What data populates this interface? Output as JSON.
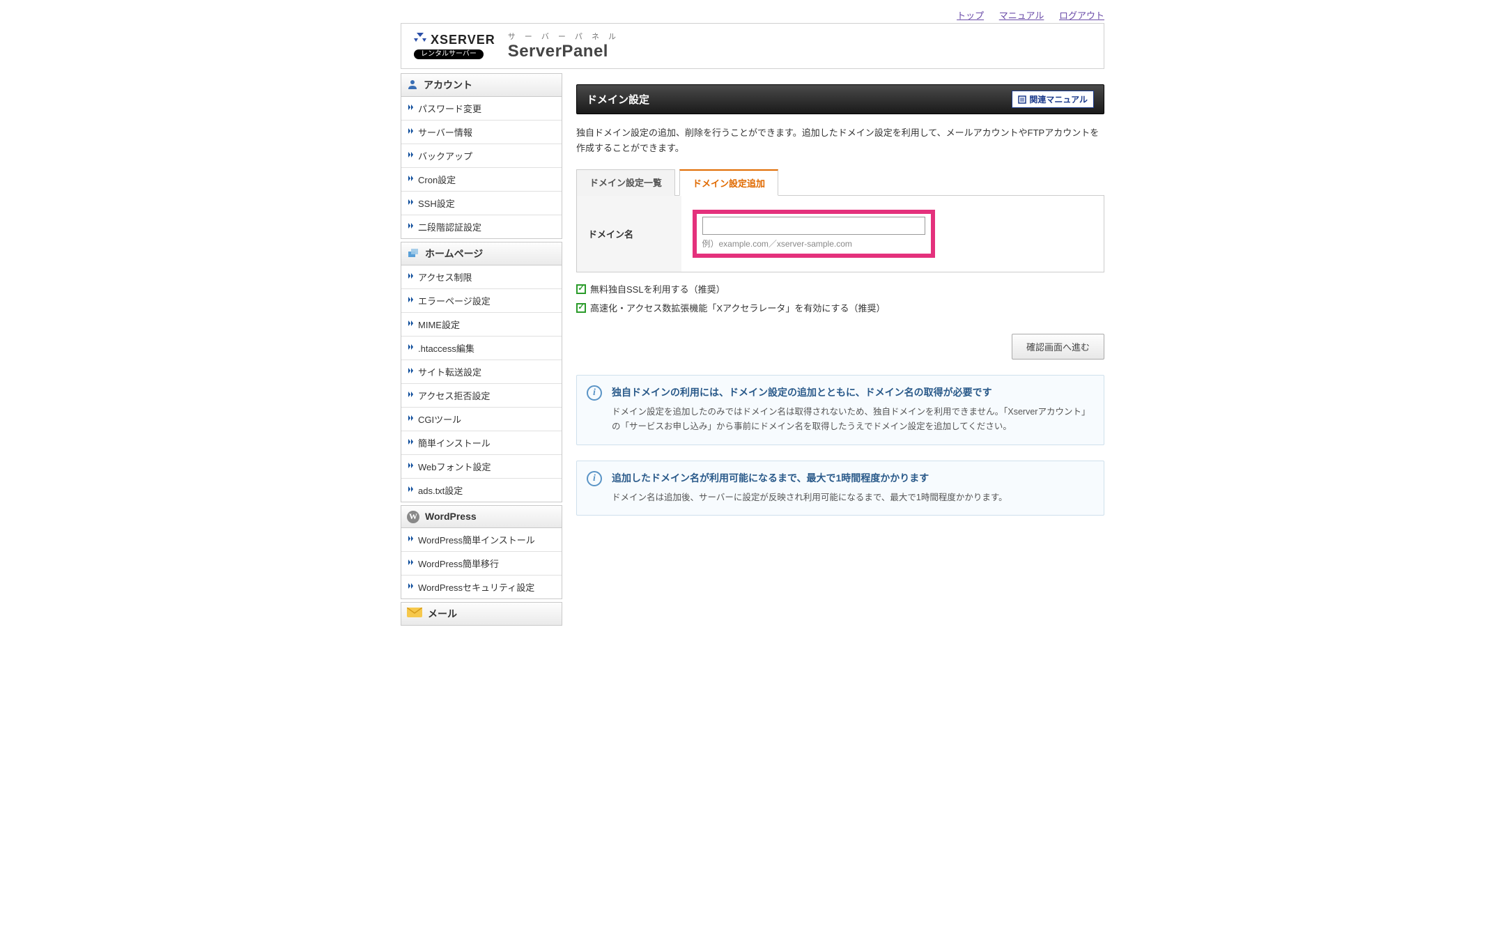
{
  "topnav": {
    "links": [
      "トップ",
      "マニュアル",
      "ログアウト"
    ]
  },
  "header": {
    "brand": "XSERVER",
    "badge": "レンタルサーバー",
    "panel_jp": "サ ー バ ー パ ネ ル",
    "panel_en": "ServerPanel"
  },
  "sidebar": {
    "sections": [
      {
        "title": "アカウント",
        "icon": "account-icon",
        "items": [
          "パスワード変更",
          "サーバー情報",
          "バックアップ",
          "Cron設定",
          "SSH設定",
          "二段階認証設定"
        ]
      },
      {
        "title": "ホームページ",
        "icon": "home-icon",
        "items": [
          "アクセス制限",
          "エラーページ設定",
          "MIME設定",
          ".htaccess編集",
          "サイト転送設定",
          "アクセス拒否設定",
          "CGIツール",
          "簡単インストール",
          "Webフォント設定",
          "ads.txt設定"
        ]
      },
      {
        "title": "WordPress",
        "icon": "wordpress-icon",
        "items": [
          "WordPress簡単インストール",
          "WordPress簡単移行",
          "WordPressセキュリティ設定"
        ]
      },
      {
        "title": "メール",
        "icon": "mail-icon",
        "items": []
      }
    ]
  },
  "main": {
    "title": "ドメイン設定",
    "manual_btn": "関連マニュアル",
    "description": "独自ドメイン設定の追加、削除を行うことができます。追加したドメイン設定を利用して、メールアカウントやFTPアカウントを作成することができます。",
    "tabs": [
      "ドメイン設定一覧",
      "ドメイン設定追加"
    ],
    "active_tab": 1,
    "form": {
      "domain_label": "ドメイン名",
      "domain_value": "",
      "domain_example": "例）example.com／xserver-sample.com"
    },
    "checks": [
      "無料独自SSLを利用する（推奨）",
      "高速化・アクセス数拡張機能「Xアクセラレータ」を有効にする（推奨）"
    ],
    "submit_label": "確認画面へ進む",
    "infos": [
      {
        "title": "独自ドメインの利用には、ドメイン設定の追加とともに、ドメイン名の取得が必要です",
        "text": "ドメイン設定を追加したのみではドメイン名は取得されないため、独自ドメインを利用できません。「Xserverアカウント」の「サービスお申し込み」から事前にドメイン名を取得したうえでドメイン設定を追加してください。"
      },
      {
        "title": "追加したドメイン名が利用可能になるまで、最大で1時間程度かかります",
        "text": "ドメイン名は追加後、サーバーに設定が反映され利用可能になるまで、最大で1時間程度かかります。"
      }
    ]
  }
}
